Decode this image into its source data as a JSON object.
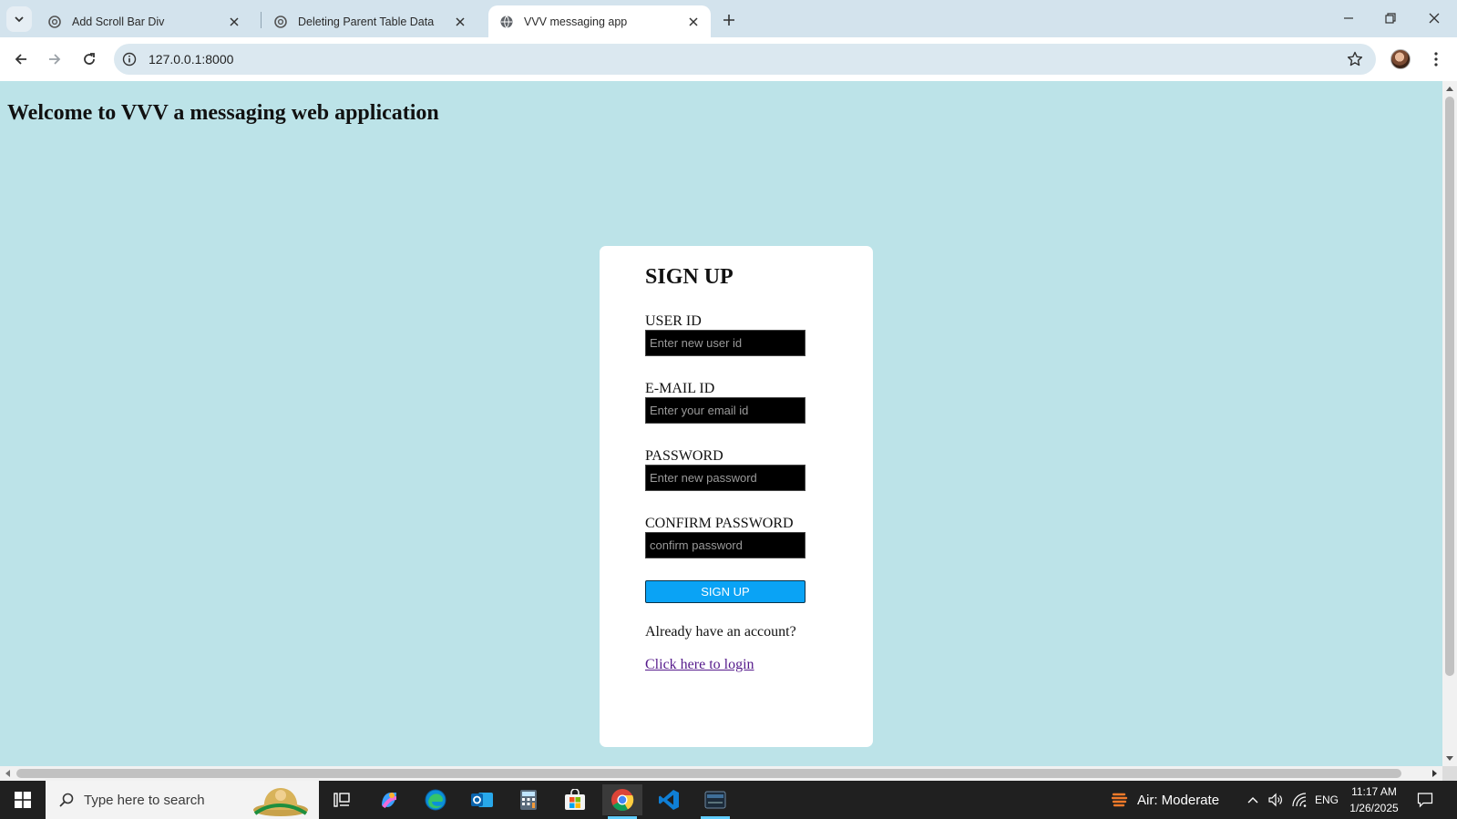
{
  "browser": {
    "tabs": [
      {
        "title": "Add Scroll Bar Div",
        "favicon": "chatgpt-icon",
        "active": false
      },
      {
        "title": "Deleting Parent Table Data",
        "favicon": "chatgpt-icon",
        "active": false
      },
      {
        "title": "VVV messaging app",
        "favicon": "globe-icon",
        "active": true
      }
    ],
    "url": "127.0.0.1:8000"
  },
  "page": {
    "heading": "Welcome to VVV a messaging web application",
    "form": {
      "title": "SIGN UP",
      "fields": [
        {
          "label": "USER ID",
          "placeholder": "Enter new user id"
        },
        {
          "label": "E-MAIL ID",
          "placeholder": "Enter your email id"
        },
        {
          "label": "PASSWORD",
          "placeholder": "Enter new password"
        },
        {
          "label": "CONFIRM PASSWORD",
          "placeholder": "confirm password"
        }
      ],
      "submit_label": "SIGN UP",
      "already_text": "Already have an account?",
      "login_link": "Click here to login"
    },
    "colors": {
      "background": "#bce3e8",
      "button": "#0aa3f5",
      "input_bg": "#000000",
      "link": "#551a8b"
    }
  },
  "taskbar": {
    "search_placeholder": "Type here to search",
    "apps": [
      "task-view-icon",
      "copilot-icon",
      "edge-icon",
      "outlook-icon",
      "calculator-icon",
      "store-icon",
      "chrome-icon",
      "vscode-icon",
      "mysql-icon"
    ],
    "air_quality": "Air: Moderate",
    "language": "ENG",
    "time": "11:17 AM",
    "date": "1/26/2025"
  }
}
